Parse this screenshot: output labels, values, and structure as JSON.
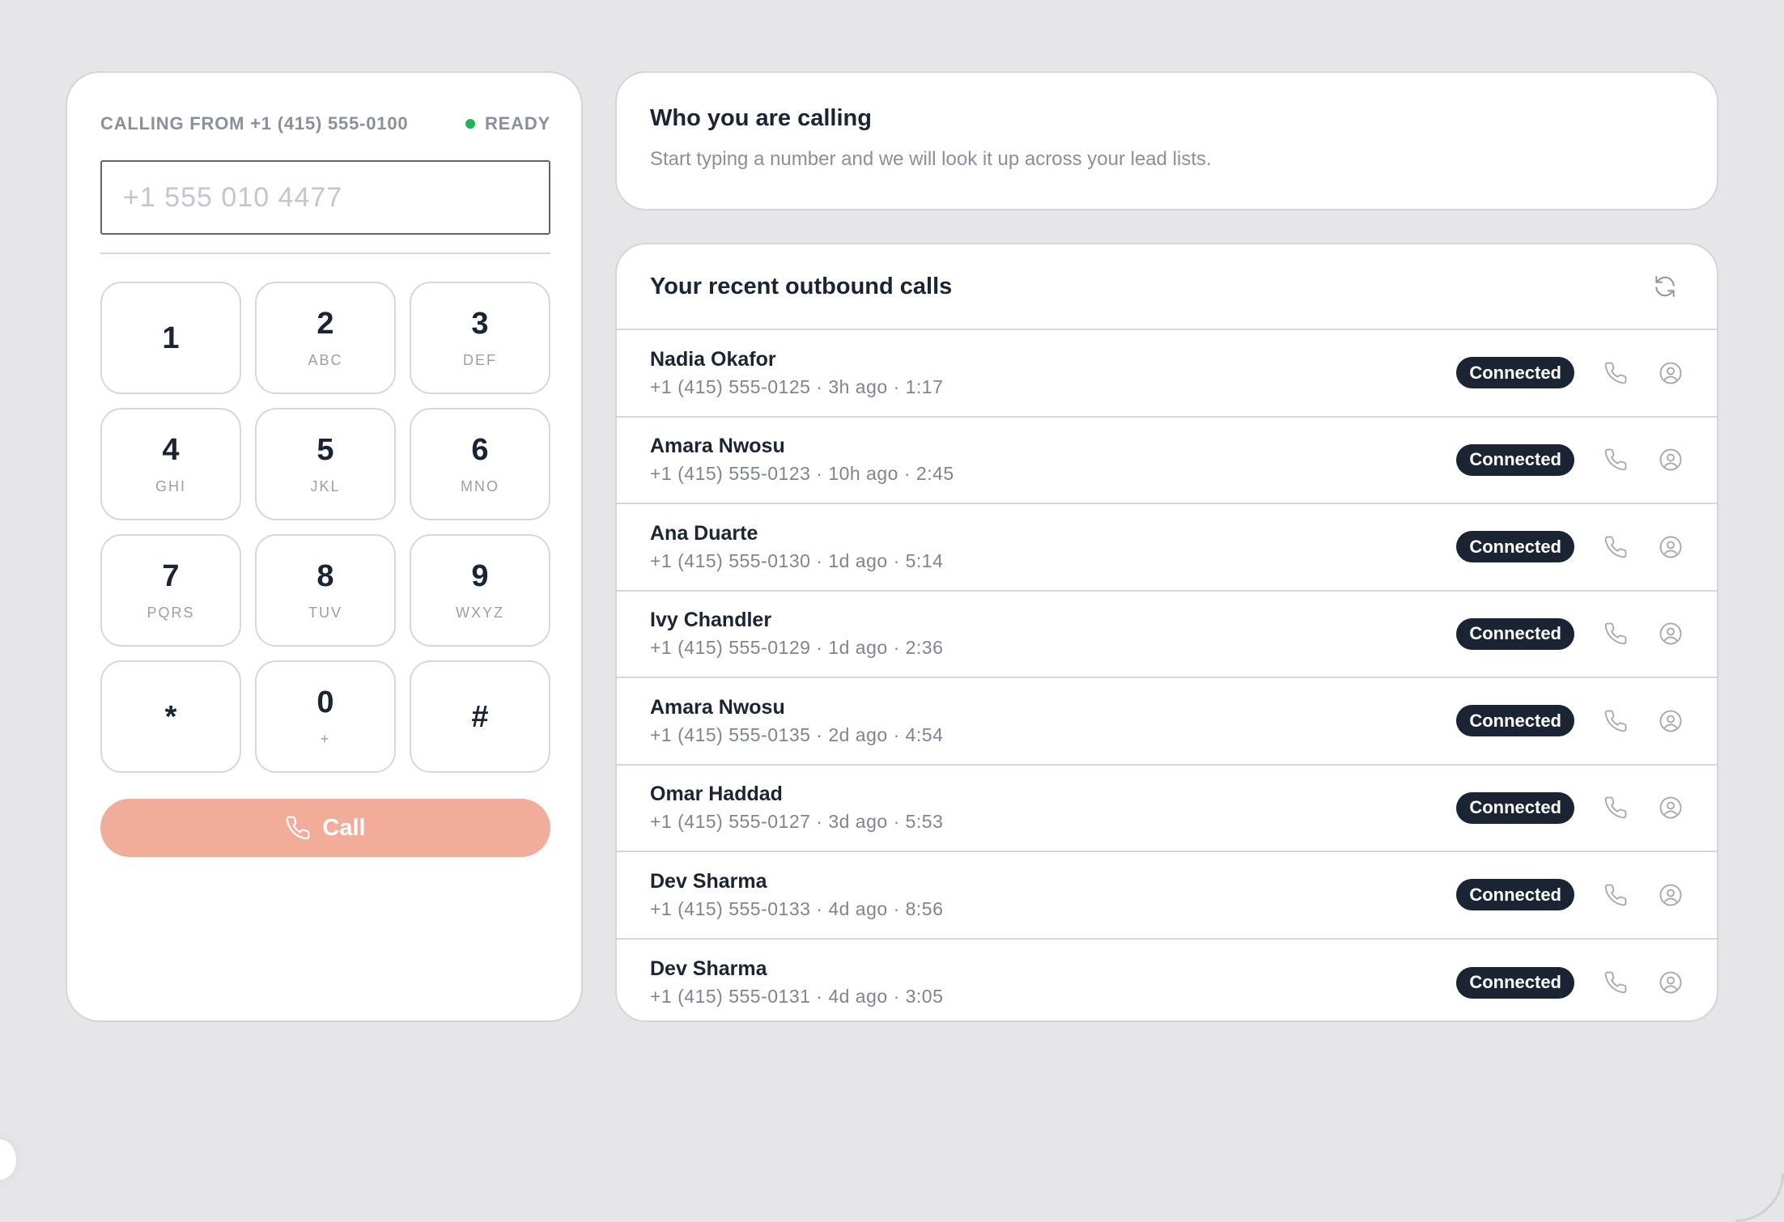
{
  "dialer": {
    "calling_from": "CALLING FROM +1 (415) 555-0100",
    "status": "READY",
    "input_placeholder": "+1 555 010 4477",
    "keys": [
      {
        "digit": "1",
        "letters": ""
      },
      {
        "digit": "2",
        "letters": "ABC"
      },
      {
        "digit": "3",
        "letters": "DEF"
      },
      {
        "digit": "4",
        "letters": "GHI"
      },
      {
        "digit": "5",
        "letters": "JKL"
      },
      {
        "digit": "6",
        "letters": "MNO"
      },
      {
        "digit": "7",
        "letters": "PQRS"
      },
      {
        "digit": "8",
        "letters": "TUV"
      },
      {
        "digit": "9",
        "letters": "WXYZ"
      },
      {
        "digit": "*",
        "letters": ""
      },
      {
        "digit": "0",
        "letters": "+"
      },
      {
        "digit": "#",
        "letters": ""
      }
    ],
    "call_label": "Call",
    "status_color": "#22b356",
    "call_color": "#f1ad9a"
  },
  "lookup": {
    "title": "Who you are calling",
    "subtitle": "Start typing a number and we will look it up across your lead lists."
  },
  "recent": {
    "title": "Your recent outbound calls",
    "refresh_icon": "refresh-icon",
    "calls": [
      {
        "name": "Nadia Okafor",
        "meta": "+1 (415) 555-0125 · 3h ago · 1:17",
        "status": "Connected"
      },
      {
        "name": "Amara Nwosu",
        "meta": "+1 (415) 555-0123 · 10h ago · 2:45",
        "status": "Connected"
      },
      {
        "name": "Ana Duarte",
        "meta": "+1 (415) 555-0130 · 1d ago · 5:14",
        "status": "Connected"
      },
      {
        "name": "Ivy Chandler",
        "meta": "+1 (415) 555-0129 · 1d ago · 2:36",
        "status": "Connected"
      },
      {
        "name": "Amara Nwosu",
        "meta": "+1 (415) 555-0135 · 2d ago · 4:54",
        "status": "Connected"
      },
      {
        "name": "Omar Haddad",
        "meta": "+1 (415) 555-0127 · 3d ago · 5:53",
        "status": "Connected"
      },
      {
        "name": "Dev Sharma",
        "meta": "+1 (415) 555-0133 · 4d ago · 8:56",
        "status": "Connected"
      },
      {
        "name": "Dev Sharma",
        "meta": "+1 (415) 555-0131 · 4d ago · 3:05",
        "status": "Connected"
      }
    ],
    "badge_color": "#1a2433"
  }
}
